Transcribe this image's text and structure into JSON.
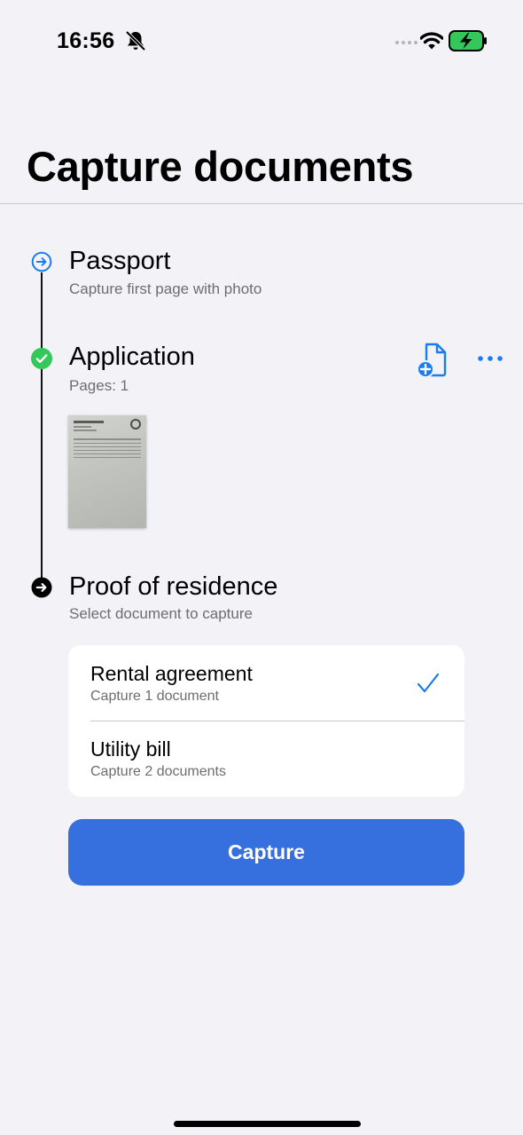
{
  "status_bar": {
    "time": "16:56"
  },
  "header": {
    "title": "Capture documents"
  },
  "steps": [
    {
      "title": "Passport",
      "subtitle": "Capture first page with photo",
      "state": "current",
      "icon": "arrow-right-circle-outline-icon"
    },
    {
      "title": "Application",
      "subtitle": "Pages: 1",
      "state": "completed",
      "icon": "checkmark-circle-icon",
      "actions": [
        "doc-add-icon",
        "more-icon"
      ]
    },
    {
      "title": "Proof of residence",
      "subtitle": "Select document to capture",
      "state": "pending",
      "icon": "arrow-right-circle-filled-icon"
    }
  ],
  "residence_options": [
    {
      "label": "Rental agreement",
      "subtitle": "Capture 1 document",
      "selected": true
    },
    {
      "label": "Utility bill",
      "subtitle": "Capture 2 documents",
      "selected": false
    }
  ],
  "capture_button": {
    "label": "Capture"
  },
  "colors": {
    "accent": "#3570de",
    "link": "#1a7bf2",
    "success": "#34c759",
    "background": "#f2f2f7"
  }
}
